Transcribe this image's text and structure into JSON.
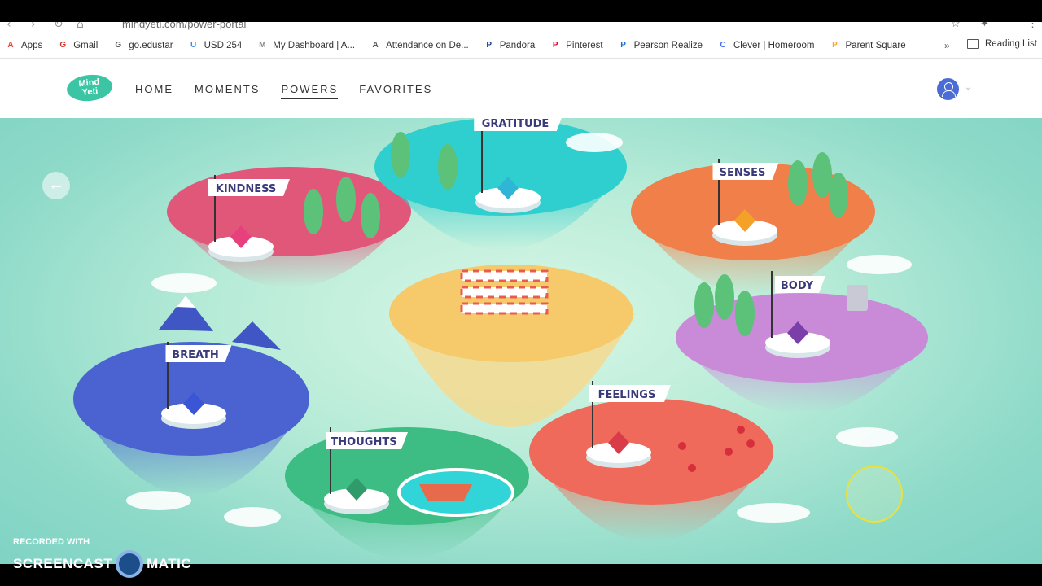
{
  "browser": {
    "url": "mindyeti.com/power-portal",
    "bookmarks": [
      {
        "label": "Apps",
        "icon": "apps-grid-icon",
        "color": "#e94235"
      },
      {
        "label": "Gmail",
        "icon": "gmail-icon",
        "color": "#d93025"
      },
      {
        "label": "go.edustar",
        "icon": "g-icon",
        "color": "#555555"
      },
      {
        "label": "USD 254",
        "icon": "google-icon",
        "color": "#4285f4"
      },
      {
        "label": "My Dashboard | A...",
        "icon": "dashboard-icon",
        "color": "#888888"
      },
      {
        "label": "Attendance on De...",
        "icon": "globe-icon",
        "color": "#555555"
      },
      {
        "label": "Pandora",
        "icon": "pandora-icon",
        "color": "#224099"
      },
      {
        "label": "Pinterest",
        "icon": "pinterest-icon",
        "color": "#e60023"
      },
      {
        "label": "Pearson Realize",
        "icon": "pearson-icon",
        "color": "#1f6fd1"
      },
      {
        "label": "Clever | Homeroom",
        "icon": "clever-icon",
        "color": "#436cf2"
      },
      {
        "label": "Parent Square",
        "icon": "parentsquare-icon",
        "color": "#f2a93b"
      }
    ],
    "more": "»",
    "reading_list": "Reading List"
  },
  "app": {
    "logo": "Mind Yeti",
    "nav": [
      {
        "label": "HOME",
        "active": false
      },
      {
        "label": "MOMENTS",
        "active": false
      },
      {
        "label": "POWERS",
        "active": true
      },
      {
        "label": "FAVORITES",
        "active": false
      }
    ]
  },
  "islands": [
    {
      "name": "KINDNESS",
      "color": "#e0577a",
      "gem": "#e8407c"
    },
    {
      "name": "GRATITUDE",
      "color": "#2fcfcf",
      "gem": "#2fb5d6"
    },
    {
      "name": "SENSES",
      "color": "#f07f4a",
      "gem": "#f4a128"
    },
    {
      "name": "BODY",
      "color": "#c98ad8",
      "gem": "#7a3fa8"
    },
    {
      "name": "BREATH",
      "color": "#4a63d0",
      "gem": "#3a56d4"
    },
    {
      "name": "THOUGHTS",
      "color": "#3dbd84",
      "gem": "#2f9a6a"
    },
    {
      "name": "FEELINGS",
      "color": "#ef6a5a",
      "gem": "#d93b48"
    }
  ],
  "back_arrow": "←",
  "watermark": {
    "line1": "RECORDED WITH",
    "line2a": "SCREENCAST",
    "line2b": "MATIC"
  }
}
